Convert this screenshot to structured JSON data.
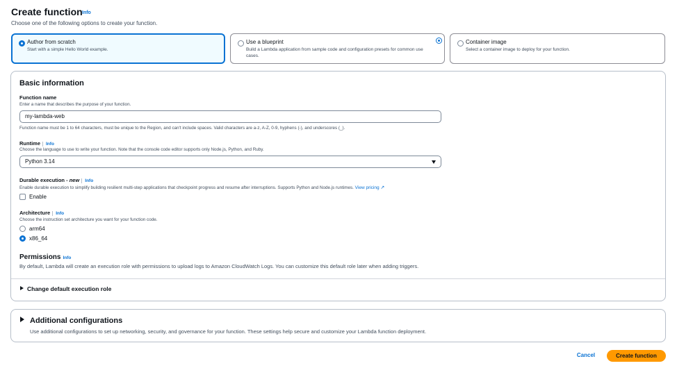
{
  "header": {
    "title": "Create function",
    "info": "Info",
    "subtitle": "Choose one of the following options to create your function."
  },
  "options": [
    {
      "title": "Author from scratch",
      "desc": "Start with a simple Hello World example.",
      "selected": true
    },
    {
      "title": "Use a blueprint",
      "desc": "Build a Lambda application from sample code and configuration presets for common use cases.",
      "selected": false
    },
    {
      "title": "Container image",
      "desc": "Select a container image to deploy for your function.",
      "selected": false
    }
  ],
  "basic": {
    "heading": "Basic information",
    "function_name": {
      "label": "Function name",
      "desc": "Enter a name that describes the purpose of your function.",
      "value": "my-lambda-web",
      "constraint": "Function name must be 1 to 64 characters, must be unique to the Region, and can't include spaces. Valid characters are a-z, A-Z, 0-9, hyphens (-), and underscores (_)."
    },
    "runtime": {
      "label": "Runtime",
      "info": "Info",
      "desc": "Choose the language to use to write your function. Note that the console code editor supports only Node.js, Python, and Ruby.",
      "value": "Python 3.14"
    },
    "durable": {
      "label": "Durable execution - ",
      "label_new": "new",
      "info": "Info",
      "desc": "Enable durable execution to simplify building resilient multi-step applications that checkpoint progress and resume after interruptions. Supports Python and Node.js runtimes.",
      "link": "View pricing",
      "checkbox_label": "Enable"
    },
    "architecture": {
      "label": "Architecture",
      "info": "Info",
      "desc": "Choose the instruction set architecture you want for your function code.",
      "options": [
        {
          "label": "arm64",
          "checked": false
        },
        {
          "label": "x86_64",
          "checked": true
        }
      ]
    },
    "permissions": {
      "heading": "Permissions",
      "info": "Info",
      "desc": "By default, Lambda will create an execution role with permissions to upload logs to Amazon CloudWatch Logs. You can customize this default role later when adding triggers."
    },
    "execution_role_label": "Change default execution role"
  },
  "additional": {
    "heading": "Additional configurations",
    "desc": "Use additional configurations to set up networking, security, and governance for your function. These settings help secure and customize your Lambda function deployment."
  },
  "footer": {
    "cancel": "Cancel",
    "create": "Create function"
  },
  "colors": {
    "accent": "#0972d3",
    "primary_button": "#ff9900",
    "selected_tile_bg": "#f0fbff"
  }
}
